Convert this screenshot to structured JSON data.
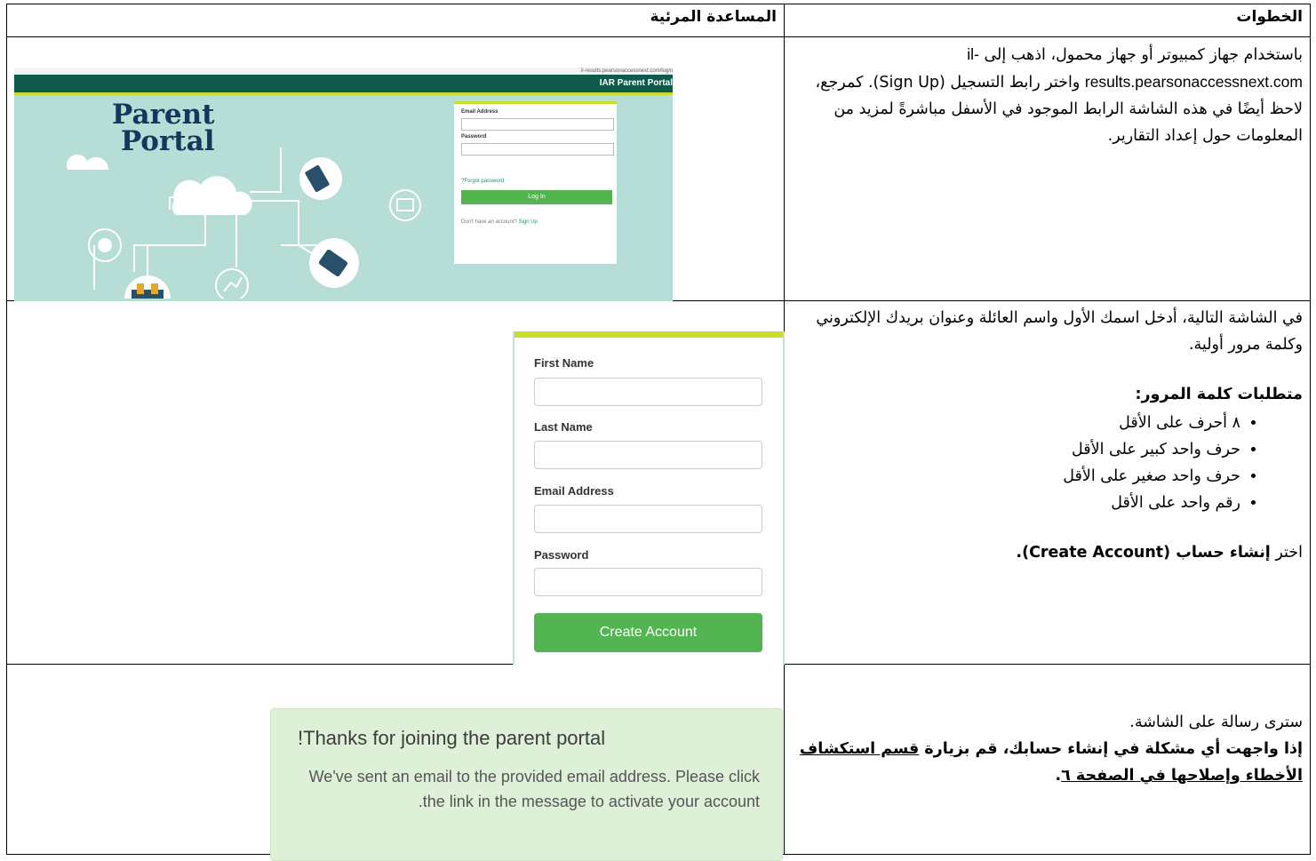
{
  "header": {
    "steps": "الخطوات",
    "visual_aid": "المساعدة المرئية"
  },
  "row1": {
    "text_a": "باستخدام جهاز كمبيوتر أو جهاز محمول، اذهب إلى ",
    "url": "il-results.pearsonaccessnext.com",
    "text_b": " واختر رابط التسجيل (Sign Up). كمرجع، لاحظ أيضًا في هذه الشاشة الرابط الموجود في الأسفل مباشرةً لمزيد من المعلومات حول إعداد التقارير.",
    "portal": {
      "browser_url": "il-results.pearsonaccessnext.com/login",
      "bar_title": "IAR Parent Portal",
      "title_line1": "Parent",
      "title_line2": "Portal",
      "email_label": "Email Address",
      "password_label": "Password",
      "forgot": "Forgot password?",
      "login_button": "Log In",
      "no_account": "Don't have an account? ",
      "sign_up": "Sign Up"
    }
  },
  "row2": {
    "intro": "في الشاشة التالية، أدخل اسمك الأول واسم العائلة وعنوان بريدك الإلكتروني وكلمة مرور أولية.",
    "req_title": "متطلبات كلمة المرور:",
    "requirements": [
      "٨ أحرف على الأقل",
      "حرف واحد كبير على الأقل",
      "حرف واحد صغير على الأقل",
      "رقم واحد على الأقل"
    ],
    "choose_prefix": "اختر ",
    "choose_bold": "إنشاء حساب (Create Account).",
    "form": {
      "first_name": "First Name",
      "last_name": "Last Name",
      "email": "Email Address",
      "password": "Password",
      "button": "Create Account"
    }
  },
  "row3": {
    "line1": "سترى رسالة على الشاشة.",
    "bold_prefix": "إذا واجهت أي مشكلة في إنشاء حسابك، قم بزيارة ",
    "link_text": "قسم استكشاف الأخطاء وإصلاحها في الصفحة ٦",
    "end": ".",
    "thanks_title": "Thanks for joining the parent portal!",
    "thanks_body": "We've sent an email to the provided email address. Please click the link in the message to activate your account."
  },
  "colors": {
    "portal_bg": "#b6ddd6",
    "portal_bar": "#0f5a4a",
    "accent_lime": "#c9dd2c",
    "button_green": "#52b552",
    "thanks_bg": "#dff0d8"
  }
}
